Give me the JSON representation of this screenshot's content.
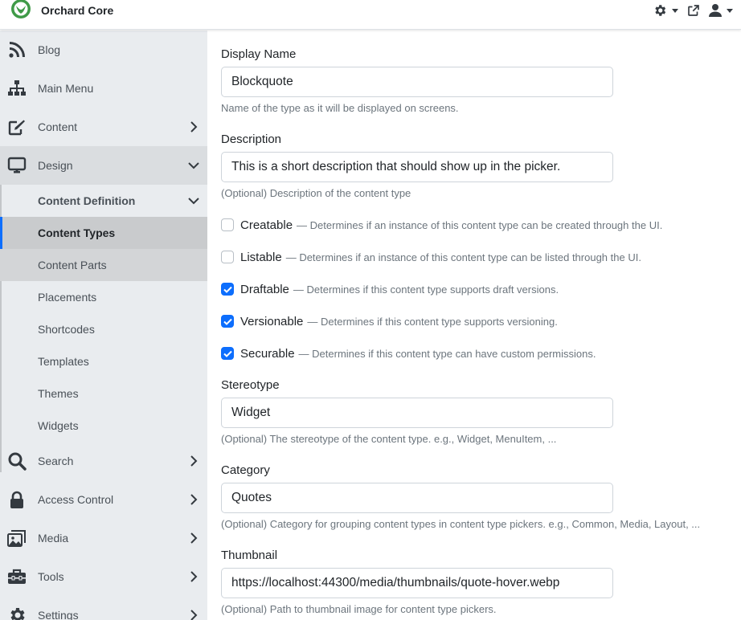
{
  "app": {
    "title": "Orchard Core"
  },
  "topbar": {
    "icons": [
      "settings-gear-icon",
      "external-link-icon",
      "user-icon"
    ]
  },
  "sidebar": {
    "items": [
      {
        "label": "Blog",
        "icon": "rss-icon"
      },
      {
        "label": "Main Menu",
        "icon": "sitemap-icon"
      },
      {
        "label": "Content",
        "icon": "edit-icon"
      },
      {
        "label": "Design",
        "icon": "desktop-icon"
      },
      {
        "label": "Search",
        "icon": "search-icon"
      },
      {
        "label": "Access Control",
        "icon": "lock-icon"
      },
      {
        "label": "Media",
        "icon": "images-icon"
      },
      {
        "label": "Tools",
        "icon": "toolbox-icon"
      },
      {
        "label": "Settings",
        "icon": "gear-icon"
      }
    ],
    "design_sub": {
      "header": "Content Definition",
      "items": [
        "Content Types",
        "Content Parts",
        "Placements",
        "Shortcodes",
        "Templates",
        "Themes",
        "Widgets"
      ]
    }
  },
  "form": {
    "display_name": {
      "label": "Display Name",
      "value": "Blockquote",
      "help": "Name of the type as it will be displayed on screens."
    },
    "description": {
      "label": "Description",
      "value": "This is a short description that should show up in the picker.",
      "help": "(Optional) Description of the content type"
    },
    "checkboxes": [
      {
        "label": "Creatable",
        "checked": false,
        "help": "— Determines if an instance of this content type can be created through the UI."
      },
      {
        "label": "Listable",
        "checked": false,
        "help": "— Determines if an instance of this content type can be listed through the UI."
      },
      {
        "label": "Draftable",
        "checked": true,
        "help": "— Determines if this content type supports draft versions."
      },
      {
        "label": "Versionable",
        "checked": true,
        "help": "— Determines if this content type supports versioning."
      },
      {
        "label": "Securable",
        "checked": true,
        "help": "— Determines if this content type can have custom permissions."
      }
    ],
    "stereotype": {
      "label": "Stereotype",
      "value": "Widget",
      "help": "(Optional) The stereotype of the content type. e.g., Widget, MenuItem, ..."
    },
    "category": {
      "label": "Category",
      "value": "Quotes",
      "help": "(Optional) Category for grouping content types in content type pickers. e.g., Common, Media, Layout, ..."
    },
    "thumbnail": {
      "label": "Thumbnail",
      "value": "https://localhost:44300/media/thumbnails/quote-hover.webp",
      "help": "(Optional) Path to thumbnail image for content type pickers."
    }
  },
  "colors": {
    "accent": "#0d6efd",
    "sidebar_bg": "#e9ecef",
    "brand_green": "#4caf50"
  }
}
